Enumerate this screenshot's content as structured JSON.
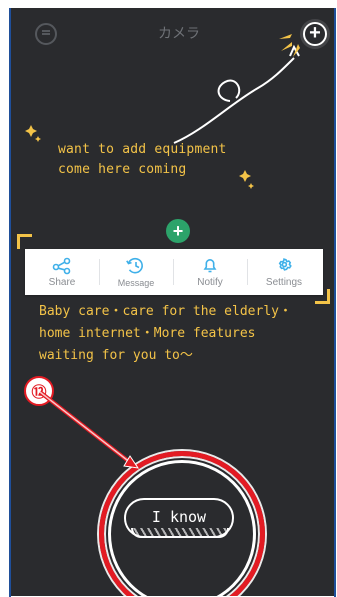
{
  "topbar": {
    "title": "カメラ",
    "left_icon": "menu-circle-icon",
    "right_icon": "plus-circle-icon"
  },
  "guide": {
    "line1": "want to add equipment",
    "line2": "come here coming"
  },
  "actions": [
    {
      "label": "Share",
      "icon": "share-icon"
    },
    {
      "label": "Message",
      "icon": "history-icon"
    },
    {
      "label": "Notify",
      "icon": "bell-icon"
    },
    {
      "label": "Settings",
      "icon": "gear-icon"
    }
  ],
  "features": {
    "line1": "Baby care・care for the elderly・",
    "line2": "home internet・More features",
    "line3": "waiting for you to～"
  },
  "step": {
    "label": "⑫"
  },
  "button": {
    "label": "I know"
  },
  "colors": {
    "background": "#2a2b2e",
    "tip": "#f3c348",
    "accent_red": "#e31b23",
    "action_blue": "#3fb0e9",
    "text_muted": "#8a8d92"
  }
}
